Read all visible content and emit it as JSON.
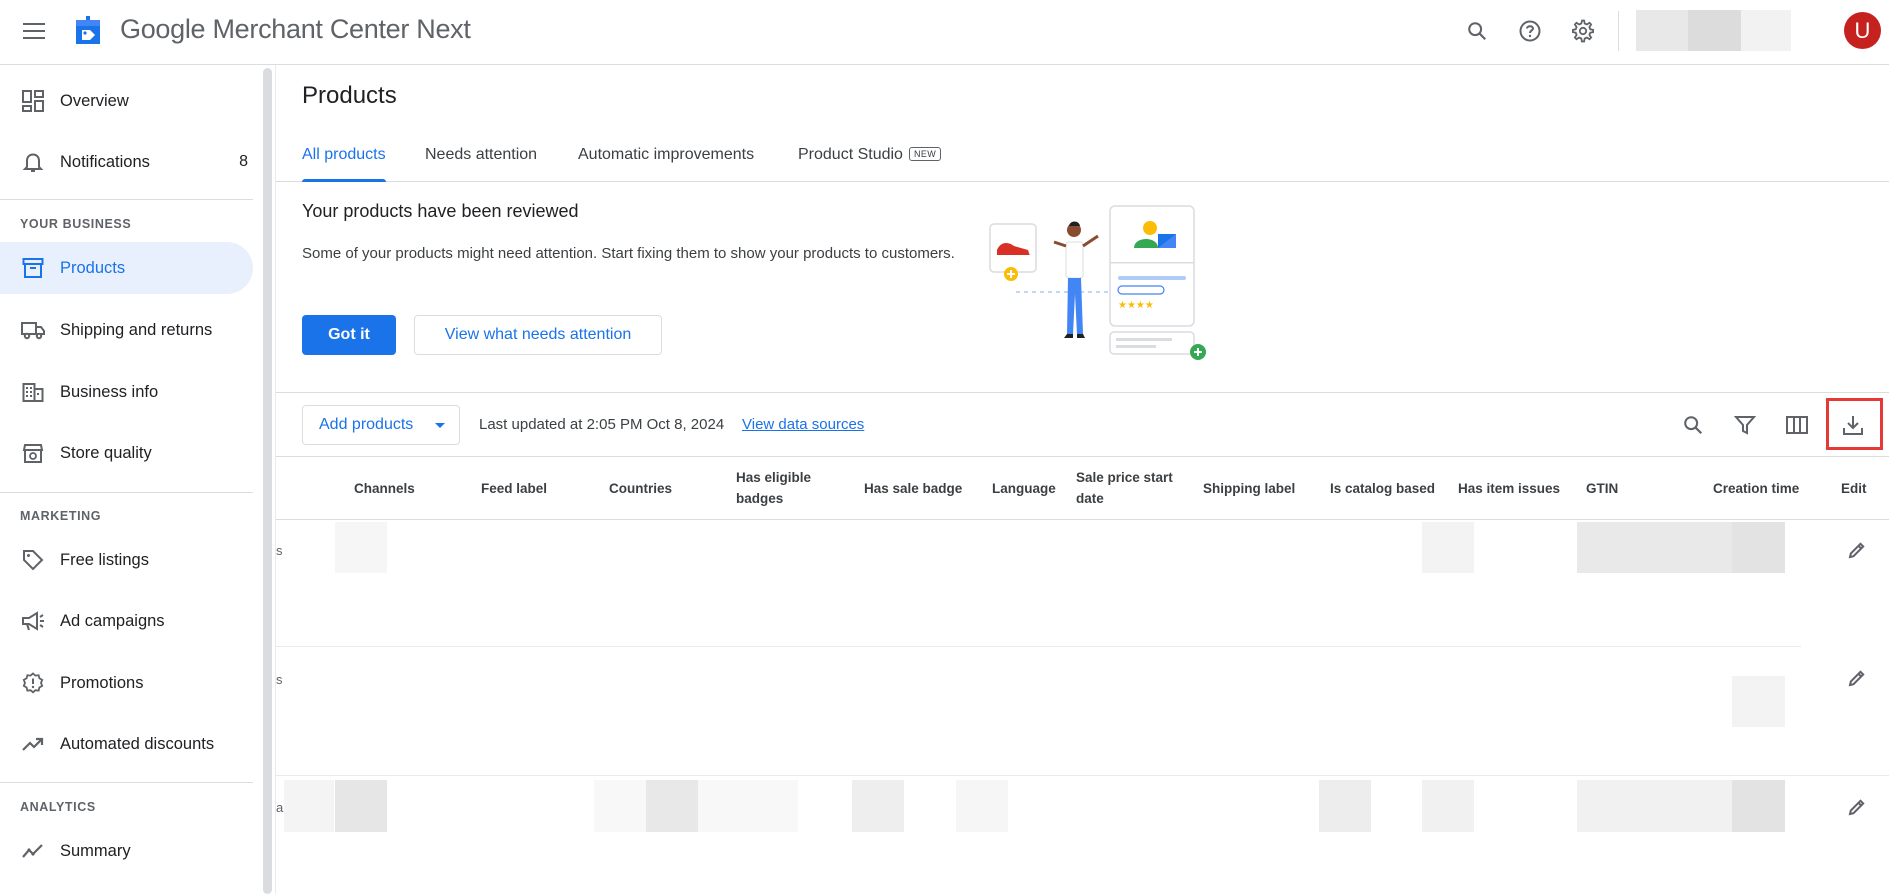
{
  "app": {
    "title_google": "Google",
    "title_rest": "Merchant Center Next",
    "avatar_letter": "U"
  },
  "topbar": {
    "icons": [
      "search-icon",
      "help-icon",
      "settings-icon"
    ]
  },
  "sidebar": {
    "overview": "Overview",
    "notifications": "Notifications",
    "notifications_count": "8",
    "section_business": "YOUR BUSINESS",
    "products": "Products",
    "shipping": "Shipping and returns",
    "business_info": "Business info",
    "store_quality": "Store quality",
    "section_marketing": "MARKETING",
    "free_listings": "Free listings",
    "ad_campaigns": "Ad campaigns",
    "promotions": "Promotions",
    "automated_discounts": "Automated discounts",
    "section_analytics": "ANALYTICS",
    "summary": "Summary"
  },
  "page": {
    "title": "Products",
    "tabs": [
      "All products",
      "Needs attention",
      "Automatic improvements",
      "Product Studio"
    ],
    "new_chip": "NEW"
  },
  "banner": {
    "title": "Your products have been reviewed",
    "text": "Some of your products might need attention. Start fixing them to show your products to customers.",
    "got_it": "Got it",
    "view_attention": "View what needs attention"
  },
  "toolbar": {
    "add_products": "Add products",
    "last_updated": "Last updated at 2:05 PM Oct 8, 2024",
    "view_sources": "View data sources"
  },
  "table": {
    "headers": {
      "channels": "Channels",
      "feed_label": "Feed label",
      "countries": "Countries",
      "has_eligible_badges": "Has eligible badges",
      "has_sale_badge": "Has sale badge",
      "language": "Language",
      "sale_price_start": "Sale price start date",
      "shipping_label": "Shipping label",
      "is_catalog_based": "Is catalog based",
      "has_item_issues": "Has item issues",
      "gtin": "GTIN",
      "creation_time": "Creation time",
      "edit": "Edit"
    },
    "rows": [
      {
        "trunc": "s"
      },
      {
        "trunc": "s"
      },
      {
        "trunc": "a"
      }
    ]
  }
}
